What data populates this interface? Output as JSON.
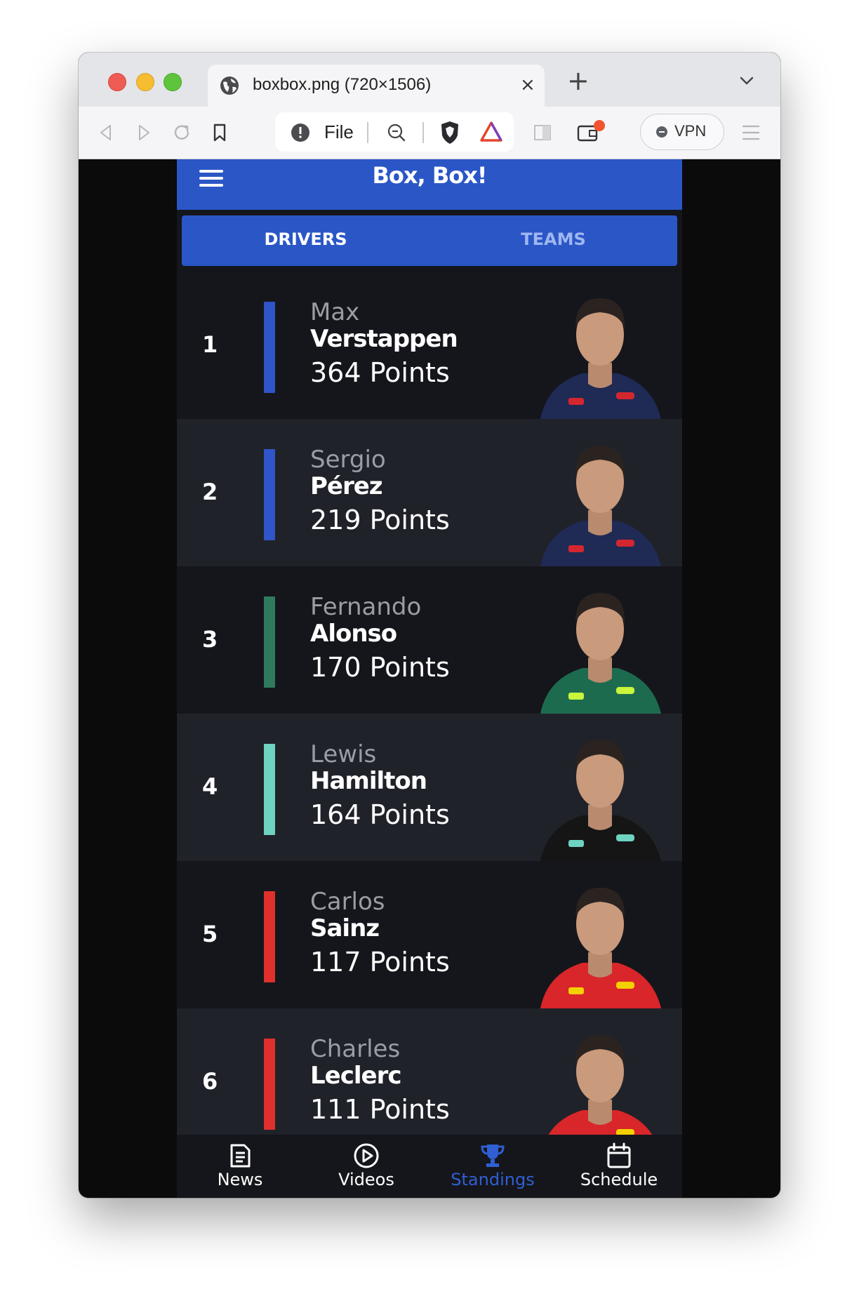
{
  "browser": {
    "tab_title": "boxbox.png (720×1506)",
    "url_label": "File",
    "vpn_label": "VPN",
    "new_tab_symbol": "+",
    "close_symbol": "×"
  },
  "app": {
    "title": "Box, Box!",
    "tabs": [
      {
        "label": "DRIVERS",
        "active": true
      },
      {
        "label": "TEAMS",
        "active": false
      }
    ],
    "drivers": [
      {
        "position": "1",
        "first_name": "Max",
        "last_name": "Verstappen",
        "points": "364 Points",
        "team_color": "#2f55c8",
        "suit_color": "#1f2a55",
        "accent": "#d4262f"
      },
      {
        "position": "2",
        "first_name": "Sergio",
        "last_name": "Pérez",
        "points": "219 Points",
        "team_color": "#2f55c8",
        "suit_color": "#1f2a55",
        "accent": "#d4262f"
      },
      {
        "position": "3",
        "first_name": "Fernando",
        "last_name": "Alonso",
        "points": "170 Points",
        "team_color": "#2f7a5e",
        "suit_color": "#1d6b4f",
        "accent": "#c9f53b"
      },
      {
        "position": "4",
        "first_name": "Lewis",
        "last_name": "Hamilton",
        "points": "164 Points",
        "team_color": "#6ed3c0",
        "suit_color": "#151515",
        "accent": "#6ed3c0"
      },
      {
        "position": "5",
        "first_name": "Carlos",
        "last_name": "Sainz",
        "points": "117 Points",
        "team_color": "#e0302d",
        "suit_color": "#d8262a",
        "accent": "#f5d000"
      },
      {
        "position": "6",
        "first_name": "Charles",
        "last_name": "Leclerc",
        "points": "111 Points",
        "team_color": "#e0302d",
        "suit_color": "#d8262a",
        "accent": "#f5d000"
      }
    ],
    "bottom_nav": [
      {
        "label": "News",
        "icon": "newspaper-icon",
        "active": false
      },
      {
        "label": "Videos",
        "icon": "play-circle-icon",
        "active": false
      },
      {
        "label": "Standings",
        "icon": "trophy-icon",
        "active": true
      },
      {
        "label": "Schedule",
        "icon": "calendar-icon",
        "active": false
      }
    ]
  }
}
